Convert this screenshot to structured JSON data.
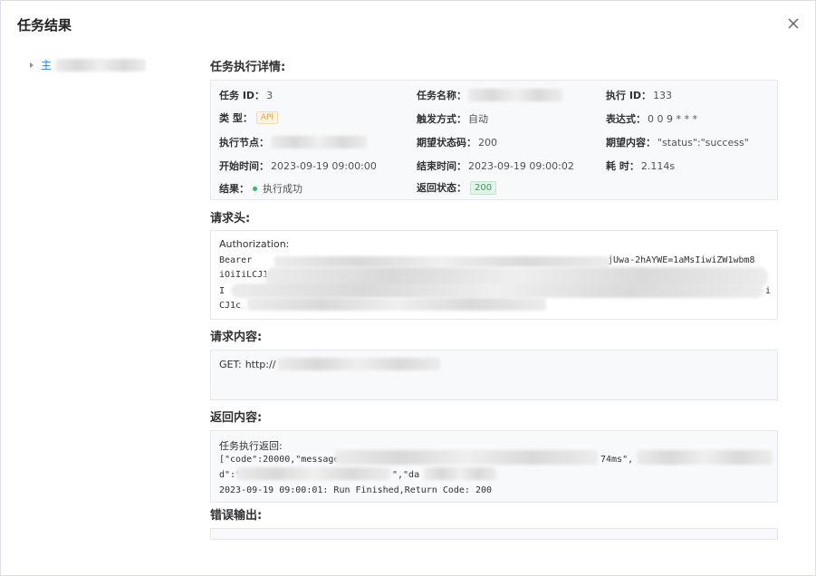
{
  "dialog": {
    "title": "任务结果",
    "close_icon": "close-icon"
  },
  "tree": {
    "node_label": "主"
  },
  "sections": {
    "detail_title": "任务执行详情:",
    "headers_title": "请求头:",
    "request_title": "请求内容:",
    "response_title": "返回内容:",
    "error_title": "错误输出:"
  },
  "details": {
    "task_id_label": "任务 ID：",
    "task_id_value": "3",
    "task_name_label": "任务名称：",
    "exec_id_label": "执行 ID：",
    "exec_id_value": "133",
    "type_label": "类 型：",
    "type_value": "API",
    "trigger_label": "触发方式：",
    "trigger_value": "自动",
    "expr_label": "表达式：",
    "expr_value": "0 0 9 * * *",
    "node_label": "执行节点：",
    "expect_code_label": "期望状态码：",
    "expect_code_value": "200",
    "expect_content_label": "期望内容：",
    "expect_content_value": "\"status\":\"success\"",
    "start_label": "开始时间：",
    "start_value": "2023-09-19 09:00:00",
    "end_label": "结束时间：",
    "end_value": "2023-09-19 09:00:02",
    "duration_label": "耗 时：",
    "duration_value": "2.114s",
    "result_label": "结果：",
    "result_value": "执行成功",
    "return_status_label": "返回状态：",
    "return_status_value": "200",
    "colors": {
      "success": "#2fbd63",
      "api_tag": "#e6a23c"
    }
  },
  "headers": {
    "key": "Authorization:",
    "line1": "Bearer",
    "line1_end": "jUwa-2hAYWE=1aMsIiwiZW1wbm8",
    "line2": "iOiIiLCJ1c",
    "line3": "I",
    "line3_end": "i",
    "line4": "CJ1c"
  },
  "request": {
    "method": "GET:",
    "url_prefix": "http://"
  },
  "response": {
    "line1": "任务执行返回:",
    "line2_start": "[\"code\":20000,\"message\":",
    "line2_mid": "74ms\",",
    "line3_start": "d\":\"",
    "line3_mid": "\",\"da",
    "line4": "2023-09-19 09:00:01: Run Finished,Return Code:  200"
  }
}
